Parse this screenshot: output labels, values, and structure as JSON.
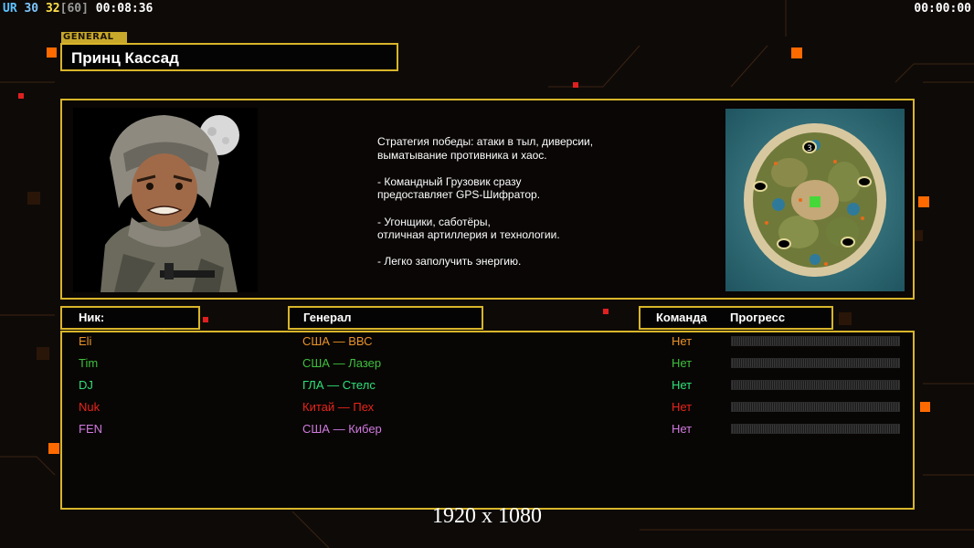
{
  "hud": {
    "ur": "UR",
    "fps_a": "30",
    "fps_b": "32",
    "fps_cap": "[60]",
    "elapsed": "00:08:36",
    "timer_right": "00:00:00"
  },
  "general_tag": "GENERAL",
  "general_name": "Принц Кассад",
  "description": "Стратегия победы: атаки в тыл, диверсии,\n выматывание противника и хаос.\n\n- Командный Грузовик сразу\nпредоставляет GPS-Шифратор.\n\n- Угонщики, саботёры,\nотличная артиллерия и технологии.\n\n- Легко заполучить энергию.",
  "map": {
    "marker_label": "3"
  },
  "headers": {
    "nick": "Ник:",
    "general": "Генерал",
    "team": "Команда",
    "progress": "Прогресс"
  },
  "players": [
    {
      "nick": "Eli",
      "general": "США — ВВС",
      "team": "Нет",
      "color": "#e8922a",
      "progress": 0
    },
    {
      "nick": "Tim",
      "general": "США — Лазер",
      "team": "Нет",
      "color": "#3fbf3f",
      "progress": 0
    },
    {
      "nick": "DJ",
      "general": "ГЛА — Стелс",
      "team": "Нет",
      "color": "#2ee07a",
      "progress": 0
    },
    {
      "nick": "Nuk",
      "general": "Китай — Пех",
      "team": "Нет",
      "color": "#e8241c",
      "progress": 0
    },
    {
      "nick": "FEN",
      "general": "США — Кибер",
      "team": "Нет",
      "color": "#d07ae0",
      "progress": 0
    }
  ],
  "resolution_label": "1920 x 1080",
  "colors": {
    "frame": "#d8b52a",
    "accent_orange": "#ff6a00"
  }
}
